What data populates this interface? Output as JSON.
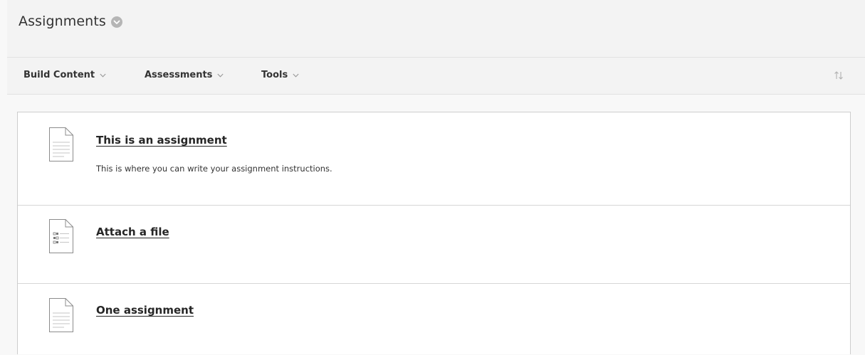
{
  "header": {
    "title": "Assignments",
    "options_icon": "chevron-down-circle-icon"
  },
  "toolbar": {
    "menus": [
      {
        "label": "Build Content",
        "icon": "chevron-down-icon"
      },
      {
        "label": "Assessments",
        "icon": "chevron-down-icon"
      },
      {
        "label": "Tools",
        "icon": "chevron-down-icon"
      }
    ],
    "reorder_icon": "reorder-arrows-icon"
  },
  "items": [
    {
      "title": "This is an assignment",
      "description": "This is where you can write your assignment instructions.",
      "icon": "document-icon"
    },
    {
      "title": "Attach a file",
      "description": "",
      "icon": "file-attachment-icon"
    },
    {
      "title": "One assignment",
      "description": "",
      "icon": "document-icon"
    }
  ],
  "colors": {
    "background": "#f8f8f8",
    "header": "#f3f3f3",
    "panel": "#ffffff",
    "border": "#cdcdcd",
    "text": "#262626"
  }
}
